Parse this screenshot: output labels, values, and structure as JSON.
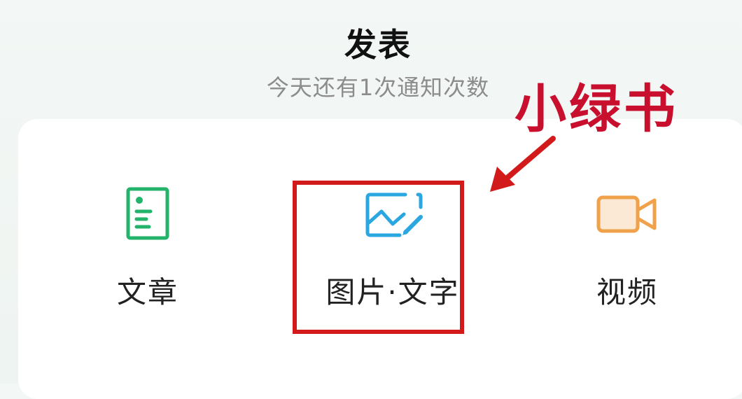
{
  "header": {
    "title": "发表",
    "subtitle": "今天还有1次通知次数"
  },
  "options": [
    {
      "label": "文章",
      "icon": "article-document-icon",
      "color": "#23b36b"
    },
    {
      "label": "图片·文字",
      "icon": "image-edit-icon",
      "color": "#2aa6e0"
    },
    {
      "label": "视频",
      "icon": "video-camera-icon",
      "color": "#f0a24a"
    }
  ],
  "annotation": {
    "text": "小绿书",
    "color": "#c8102e",
    "highlighted_option": "图片·文字"
  }
}
